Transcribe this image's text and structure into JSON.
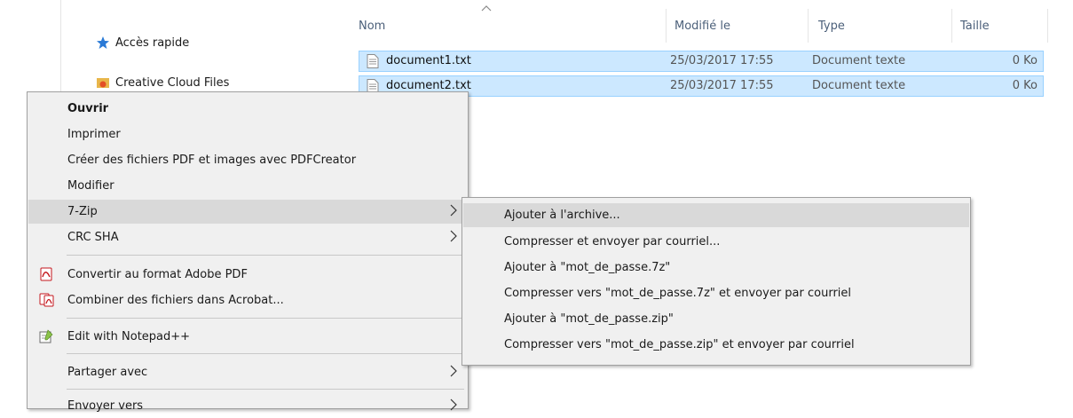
{
  "navigation": {
    "quick_access": "Accès rapide",
    "creative_cloud": "Creative Cloud Files"
  },
  "columns": {
    "name": "Nom",
    "modified": "Modifié le",
    "type": "Type",
    "size": "Taille"
  },
  "files": [
    {
      "name": "document1.txt",
      "modified": "25/03/2017 17:55",
      "type": "Document texte",
      "size": "0 Ko"
    },
    {
      "name": "document2.txt",
      "modified": "25/03/2017 17:55",
      "type": "Document texte",
      "size": "0 Ko"
    }
  ],
  "context_menu": {
    "open": "Ouvrir",
    "print": "Imprimer",
    "pdfcreator": "Créer des fichiers PDF et images avec PDFCreator",
    "edit": "Modifier",
    "sevenzip": "7-Zip",
    "crc_sha": "CRC SHA",
    "convert_pdf": "Convertir au format Adobe PDF",
    "combine_acrobat": "Combiner des fichiers dans Acrobat...",
    "notepadpp": "Edit with Notepad++",
    "share_with": "Partager avec",
    "send_to": "Envoyer vers"
  },
  "sevenzip_submenu": {
    "add_archive": "Ajouter à l'archive...",
    "compress_email": "Compresser et envoyer par courriel...",
    "add_7z": "Ajouter à \"mot_de_passe.7z\"",
    "compress_7z_email": "Compresser vers \"mot_de_passe.7z\" et envoyer par courriel",
    "add_zip": "Ajouter à \"mot_de_passe.zip\"",
    "compress_zip_email": "Compresser vers \"mot_de_passe.zip\" et envoyer par courriel"
  },
  "colors": {
    "selection": "#cce8ff",
    "selection_border": "#99d1ff",
    "menu_bg": "#f0f0f0",
    "menu_highlight": "#d9d9d9",
    "header_text": "#4c607a"
  }
}
